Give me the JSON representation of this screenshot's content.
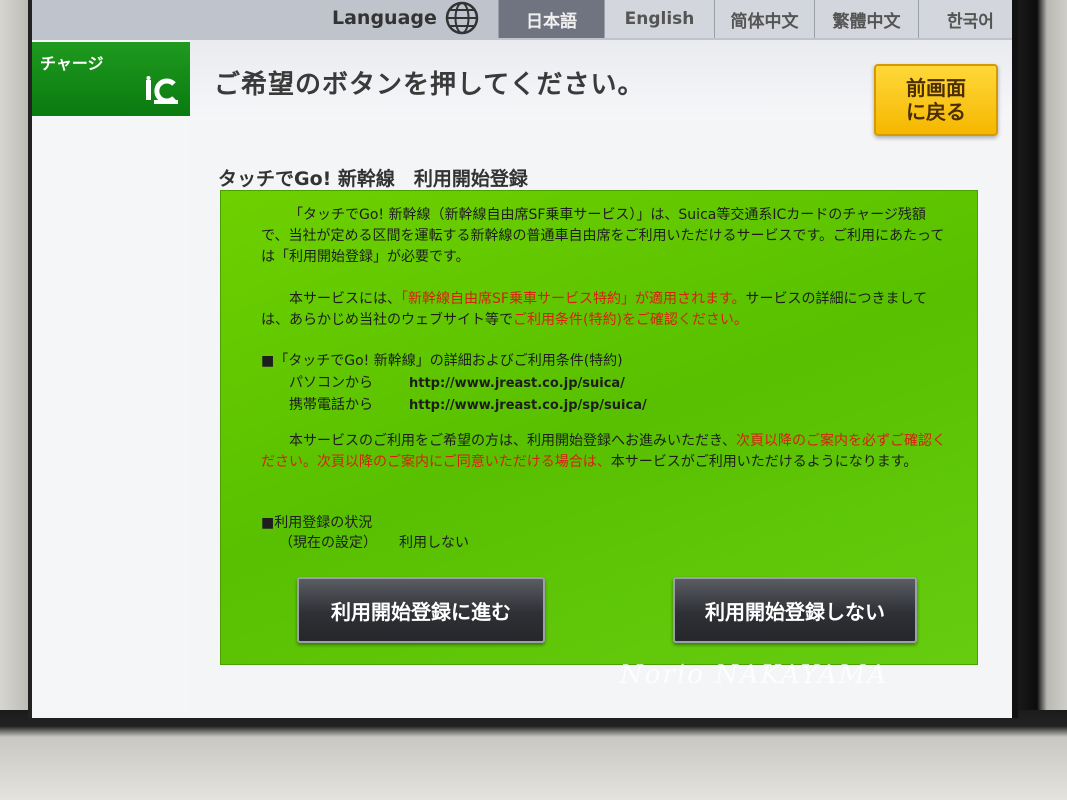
{
  "language_bar": {
    "title": "Language",
    "buttons": [
      {
        "label": "日本語",
        "active": true
      },
      {
        "label": "English",
        "active": false
      },
      {
        "label": "简体中文",
        "active": false
      },
      {
        "label": "繁體中文",
        "active": false
      },
      {
        "label": "한국어",
        "active": false
      }
    ]
  },
  "sidebar": {
    "tab_label": "チャージ",
    "tab_icon": "ic-card-icon",
    "accent": "#0a7a10"
  },
  "header": {
    "instruction": "ご希望のボタンを押してください。",
    "back_button": "前画面\nに戻る",
    "back_color": "#f5b700"
  },
  "section_title": "タッチでGo! 新幹線　利用開始登録",
  "panel": {
    "para1": "「タッチでGo! 新幹線（新幹線自由席SF乗車サービス）」は、Suica等交通系ICカードのチャージ残額で、当社が定める区間を運転する新幹線の普通車自由席をご利用いただけるサービスです。ご利用にあたっては「利用開始登録」が必要です。",
    "para2": {
      "a": "本サービスには、",
      "b": "「新幹線自由席SF乗車サービス特約」が適用されます。",
      "c": "サービスの詳細につきましては、あらかじめ当社のウェブサイト等で",
      "d": "ご利用条件(特約)をご確認ください。"
    },
    "details_title": "■「タッチでGo! 新幹線」の詳細およびご利用条件(特約)",
    "urls": [
      {
        "label": "パソコンから",
        "url": "http://www.jreast.co.jp/suica/"
      },
      {
        "label": "携帯電話から",
        "url": "http://www.jreast.co.jp/sp/suica/"
      }
    ],
    "para3": {
      "a": "本サービスのご利用をご希望の方は、利用開始登録へお進みいただき、",
      "b": "次頁以降のご案内を必ずご確認ください。次頁以降のご案内にご同意いただける場合は、",
      "c": "本サービスがご利用いただけるようになります。"
    },
    "status_title": "■利用登録の状況",
    "status_label": "（現在の設定）",
    "status_value": "利用しない",
    "btn_proceed": "利用開始登録に進む",
    "btn_decline": "利用開始登録しない",
    "panel_color": "#5ec400",
    "warning_color": "#d82010"
  },
  "watermark": "Norio NAKAYAMA"
}
